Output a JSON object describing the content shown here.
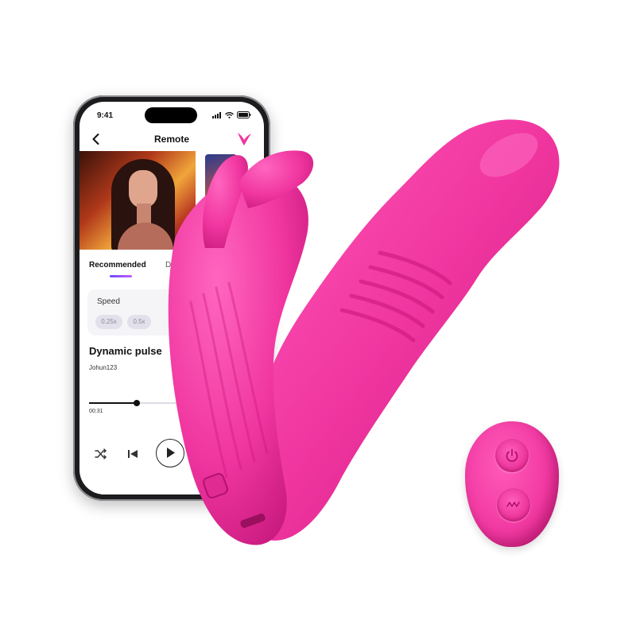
{
  "colors": {
    "product_pink": "#f0359f",
    "accent_purple": "#7a4cff",
    "phone_frame": "#1c1c1e"
  },
  "phone": {
    "status_bar": {
      "time": "9:41",
      "icons": [
        "signal-icon",
        "wifi-icon",
        "battery-icon"
      ]
    },
    "header": {
      "title": "Remote",
      "back_icon": "chevron-left-icon",
      "logo_icon": "brand-heart-logo"
    },
    "tabs": [
      {
        "label": "Recommended",
        "active": true
      },
      {
        "label": "Di",
        "active": false
      }
    ],
    "speed": {
      "label": "Speed",
      "options": [
        "0.25x",
        "0.5x"
      ]
    },
    "track": {
      "title": "Dynamic pulse",
      "artist": "Johun123",
      "elapsed": "00:31",
      "progress_fraction": 0.3
    },
    "controls": [
      "shuffle-icon",
      "previous-icon",
      "play-icon"
    ]
  },
  "remote": {
    "buttons": [
      "power-icon",
      "wave-mode-icon"
    ]
  }
}
